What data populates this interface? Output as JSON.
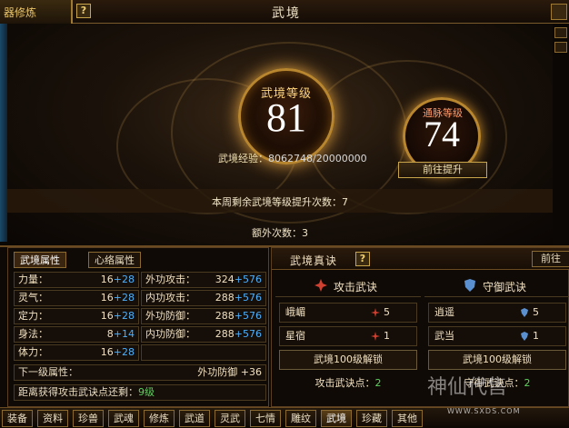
{
  "window": {
    "left_tab": "器修炼",
    "help": "?",
    "title": "武境"
  },
  "main": {
    "level_label": "武境等级",
    "level_value": "81",
    "exp_label": "武境经验：",
    "exp_value": "8062748/20000000",
    "meridian_label": "通脉等级",
    "meridian_value": "74",
    "goto_button": "前往提升",
    "weekly_text": "本周剩余武境等级提升次数：7",
    "extra_text": "额外次数：3"
  },
  "left_panel": {
    "tabs": [
      "武境属性",
      "心络属性"
    ],
    "stats": [
      {
        "l_label": "力量：",
        "l_base": "16",
        "l_plus": "+28",
        "r_label": "外功攻击：",
        "r_base": "324",
        "r_plus": "+576"
      },
      {
        "l_label": "灵气：",
        "l_base": "16",
        "l_plus": "+28",
        "r_label": "内功攻击：",
        "r_base": "288",
        "r_plus": "+576"
      },
      {
        "l_label": "定力：",
        "l_base": "16",
        "l_plus": "+28",
        "r_label": "外功防御：",
        "r_base": "288",
        "r_plus": "+576"
      },
      {
        "l_label": "身法：",
        "l_base": "8",
        "l_plus": "+14",
        "r_label": "内功防御：",
        "r_base": "288",
        "r_plus": "+576"
      },
      {
        "l_label": "体力：",
        "l_base": "16",
        "l_plus": "+28",
        "r_label": "",
        "r_base": "",
        "r_plus": ""
      }
    ],
    "next_label": "下一级属性：",
    "next_value": "外功防御 +36",
    "dist_label": "距离获得攻击武诀点还剩：",
    "dist_value": "9级"
  },
  "right_panel": {
    "title": "武境真诀",
    "help": "?",
    "goto": "前往",
    "attack": {
      "title": "攻击武诀",
      "skills": [
        {
          "name": "峨嵋",
          "level": "5"
        },
        {
          "name": "星宿",
          "level": "1"
        }
      ],
      "unlock": "武境100级解锁",
      "points_label": "攻击武诀点：",
      "points_value": "2"
    },
    "defense": {
      "title": "守御武诀",
      "skills": [
        {
          "name": "逍遥",
          "level": "5"
        },
        {
          "name": "武当",
          "level": "1"
        }
      ],
      "unlock": "武境100级解锁",
      "points_label": "守御武诀点：",
      "points_value": "2"
    }
  },
  "tabbar": [
    "装备",
    "资料",
    "珍兽",
    "武魂",
    "修炼",
    "武道",
    "灵武",
    "七情",
    "雕纹",
    "武境",
    "珍藏",
    "其他"
  ],
  "watermark": {
    "text": "神仙代售",
    "url": "WWW.SXDS.COM"
  },
  "colors": {
    "accent_gold": "#c8a44a",
    "plus_blue": "#4ab0ff",
    "green": "#60d060",
    "attack_red": "#d04030",
    "defense_blue": "#5a90d0"
  }
}
